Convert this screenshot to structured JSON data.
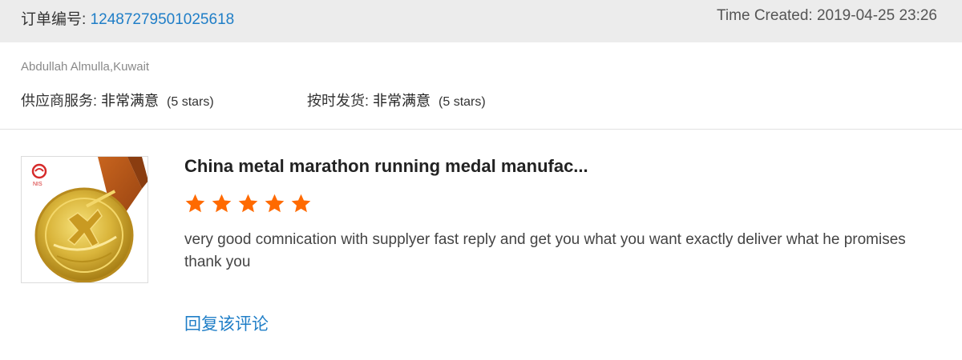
{
  "order": {
    "label": "订单编号: ",
    "number": "12487279501025618",
    "time_created": "Time Created: 2019-04-25 23:26"
  },
  "buyer": {
    "name": "Abdullah Almulla,Kuwait"
  },
  "ratings": {
    "supplier_service": {
      "label": "供应商服务: ",
      "value": "非常满意",
      "stars_note": "(5 stars)",
      "stars": 5
    },
    "on_time_shipment": {
      "label": "按时发货: ",
      "value": "非常满意",
      "stars_note": "(5 stars)",
      "stars": 5
    }
  },
  "product": {
    "title": "China metal marathon running medal manufac...",
    "thumbnail_icon": "gold-medal-with-orange-ribbon",
    "logo_text": "NIS",
    "star_rating": 5,
    "star_color": "#ff6a00"
  },
  "review": {
    "text": "very good comnication with supplyer fast reply and get you what you want exactly deliver what he promises thank you"
  },
  "actions": {
    "reply_label": "回复该评论"
  }
}
